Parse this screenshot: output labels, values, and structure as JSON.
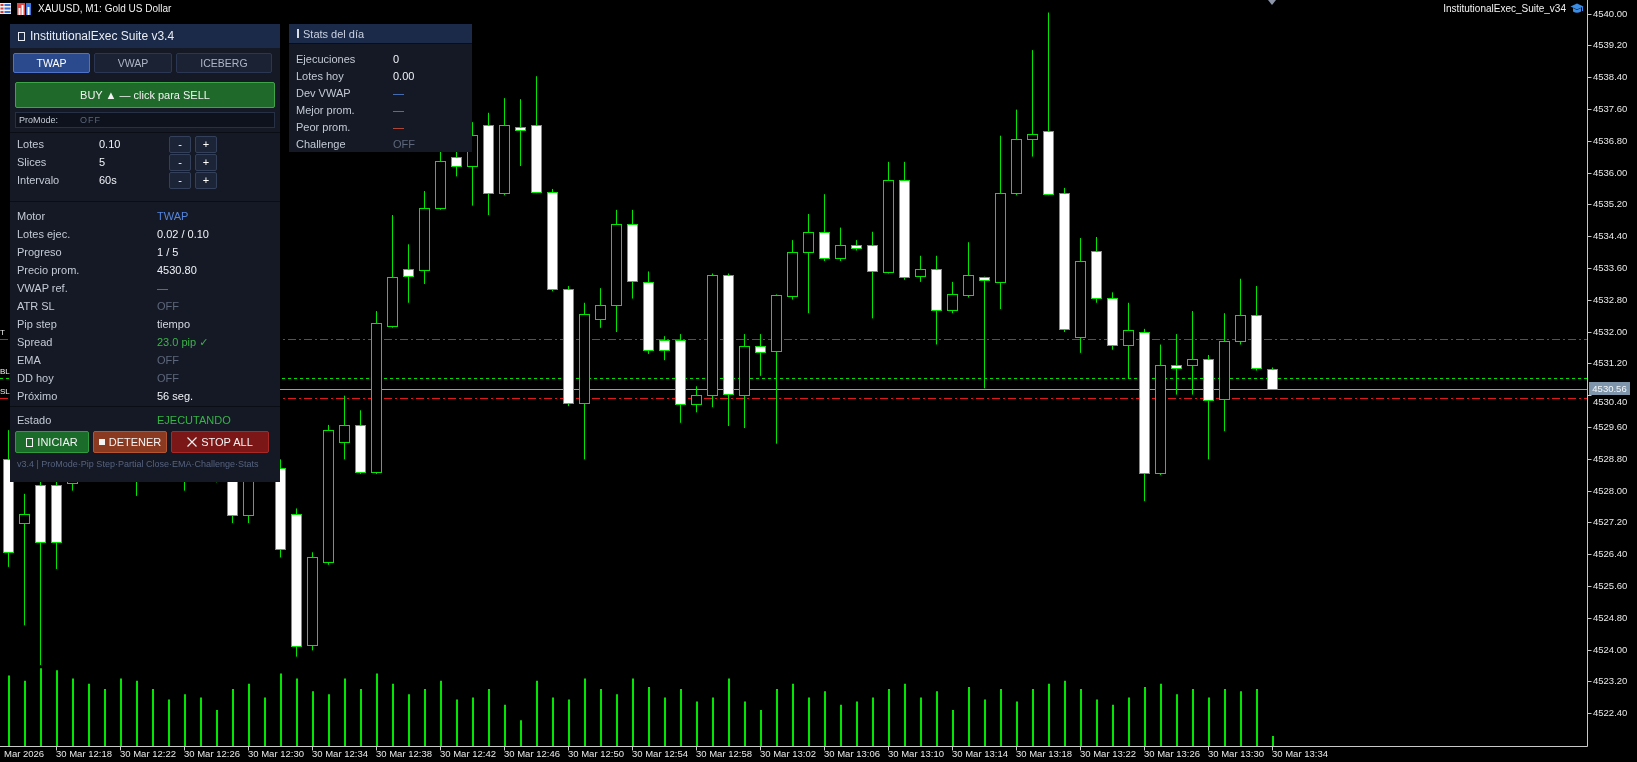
{
  "chart_header": {
    "symbol_title": "XAUUSD, M1: Gold US Dollar",
    "expert_name": "InstitutionalExec_Suite_v34"
  },
  "exec_panel": {
    "title": "InstitutionalExec Suite v3.4",
    "tabs": [
      {
        "label": "TWAP",
        "selected": true
      },
      {
        "label": "VWAP",
        "selected": false
      },
      {
        "label": "ICEBERG",
        "selected": false
      }
    ],
    "direction_button": {
      "label": "BUY ▲ — click para SELL"
    },
    "promode": {
      "label": "ProMode:",
      "value": "OFF"
    },
    "params": [
      {
        "label": "Lotes",
        "value": "0.10",
        "minus": "-",
        "plus": "+"
      },
      {
        "label": "Slices",
        "value": "5",
        "minus": "-",
        "plus": "+"
      },
      {
        "label": "Intervalo",
        "value": "60s",
        "minus": "-",
        "plus": "+"
      }
    ],
    "info_rows": [
      {
        "label": "Motor",
        "value": "TWAP",
        "kind": "accent"
      },
      {
        "label": "Lotes ejec.",
        "value": "0.02 / 0.10",
        "kind": "value"
      },
      {
        "label": "Progreso",
        "value": "1 / 5",
        "kind": "value"
      },
      {
        "label": "Precio prom.",
        "value": "4530.80",
        "kind": "value"
      },
      {
        "label": "VWAP ref.",
        "value": "—",
        "kind": "accent"
      },
      {
        "label": "ATR SL",
        "value": "OFF",
        "kind": "off"
      },
      {
        "label": "Pip step",
        "value": "tiempo",
        "kind": "plain"
      },
      {
        "label": "Spread",
        "value": "23.0 pip ✓",
        "kind": "positive"
      },
      {
        "label": "EMA",
        "value": "OFF",
        "kind": "off"
      },
      {
        "label": "DD hoy",
        "value": "OFF",
        "kind": "off"
      },
      {
        "label": "Próximo",
        "value": "56 seg.",
        "kind": "value"
      }
    ],
    "status": {
      "label": "Estado",
      "value": "EJECUTANDO"
    },
    "action_buttons": [
      {
        "label": "INICIAR",
        "kind": "start"
      },
      {
        "label": "DETENER",
        "kind": "stop"
      },
      {
        "label": "STOP ALL",
        "kind": "stop_all"
      }
    ],
    "footer": "v3.4 | ProMode·Pip Step·Partial Close·EMA·Challenge·Stats"
  },
  "stats_panel": {
    "title": "Stats del día",
    "rows": [
      {
        "label": "Ejecuciones",
        "value": "0",
        "kind": "value"
      },
      {
        "label": "Lotes hoy",
        "value": "0.00",
        "kind": "value"
      },
      {
        "label": "Dev VWAP",
        "value": "—",
        "kind": "accent"
      },
      {
        "label": "Mejor prom.",
        "value": "—",
        "kind": "positive"
      },
      {
        "label": "Peor prom.",
        "value": "—",
        "kind": "negative"
      },
      {
        "label": "Challenge",
        "value": "OFF",
        "kind": "off"
      }
    ]
  },
  "chart": {
    "level_lines": [
      {
        "kind": "tp",
        "label": "T"
      },
      {
        "kind": "breakeven",
        "label": "BL"
      },
      {
        "kind": "bid"
      },
      {
        "kind": "sl",
        "label": "SL"
      }
    ],
    "price_tag": "4530.56",
    "price_axis": [
      "4540.00",
      "4539.20",
      "4538.40",
      "4537.60",
      "4536.80",
      "4536.00",
      "4535.20",
      "4534.40",
      "4533.60",
      "4532.80",
      "4532.00",
      "4531.20",
      "4530.40",
      "4529.60",
      "4528.80",
      "4528.00",
      "4527.20",
      "4526.40",
      "4525.60",
      "4524.80",
      "4524.00",
      "4523.20",
      "4522.40"
    ],
    "time_axis": [
      "Mar 2026",
      "30 Mar 12:18",
      "30 Mar 12:22",
      "30 Mar 12:26",
      "30 Mar 12:30",
      "30 Mar 12:34",
      "30 Mar 12:38",
      "30 Mar 12:42",
      "30 Mar 12:46",
      "30 Mar 12:50",
      "30 Mar 12:54",
      "30 Mar 12:58",
      "30 Mar 13:02",
      "30 Mar 13:06",
      "30 Mar 13:10",
      "30 Mar 13:14",
      "30 Mar 13:18",
      "30 Mar 13:22",
      "30 Mar 13:26",
      "30 Mar 13:30",
      "30 Mar 13:34"
    ]
  }
}
